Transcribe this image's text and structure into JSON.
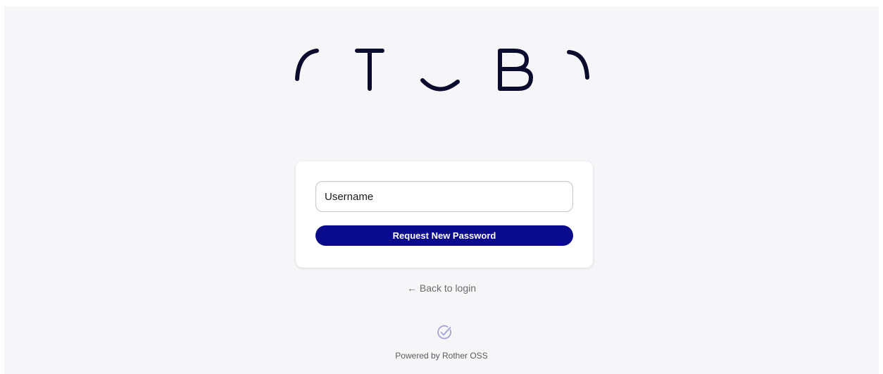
{
  "logo": {
    "name": "logo-icon",
    "color": "#0b0b2e"
  },
  "form": {
    "username_placeholder": "Username",
    "username_value": "",
    "request_button_label": "Request New Password"
  },
  "links": {
    "back_to_login": "← Back to login"
  },
  "footer": {
    "icon": "check-circle-icon",
    "powered_by": "Powered by Rother OSS"
  },
  "colors": {
    "background": "#f6f6f9",
    "card": "#ffffff",
    "primary_button": "#0a0a8c",
    "logo": "#0b0b2e",
    "footer_icon": "#a3a3d6"
  }
}
